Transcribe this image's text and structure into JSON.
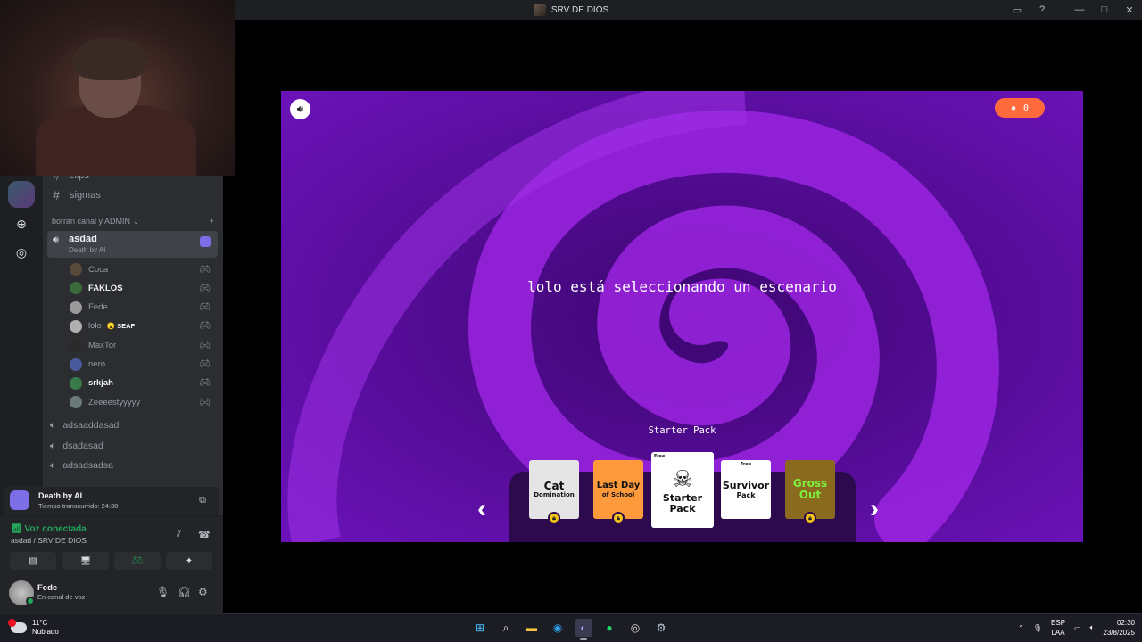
{
  "window": {
    "title": "SRV DE DIOS"
  },
  "sidebar": {
    "text_channels": [
      {
        "label": "clips"
      },
      {
        "label": "sigmas"
      }
    ],
    "category": "borran canal y ADMIN",
    "active_voice": {
      "name": "asdad",
      "activity": "Death by AI"
    },
    "members": [
      {
        "name": "Coca",
        "bold": false,
        "color": "#5a4a3a"
      },
      {
        "name": "FAKLOS",
        "bold": true,
        "color": "#3a6a3a"
      },
      {
        "name": "Fede",
        "bold": false,
        "color": "#9a9a9a"
      },
      {
        "name": "lolo",
        "bold": false,
        "color": "#b0b0b0",
        "tag": "SEAF"
      },
      {
        "name": "MaxTor",
        "bold": false,
        "color": "#2a2a2a"
      },
      {
        "name": "nero",
        "bold": false,
        "color": "#4a5a9a"
      },
      {
        "name": "srkjah",
        "bold": true,
        "color": "#3a7a4a"
      },
      {
        "name": "Zeeeestyyyyy",
        "bold": false,
        "color": "#6a7a7a"
      }
    ],
    "voice_channels": [
      {
        "label": "adsaaddasad"
      },
      {
        "label": "dsadasad"
      },
      {
        "label": "adsadsadsa"
      }
    ]
  },
  "activity_panel": {
    "title": "Death by AI",
    "elapsed": "Tiempo transcurrido: 24:38"
  },
  "voice_panel": {
    "status": "Voz conectada",
    "location": "asdad / SRV DE DIOS"
  },
  "user_panel": {
    "name": "Fede",
    "status": "En canal de voz"
  },
  "game": {
    "counter": "0",
    "status_message": "lolo está seleccionando un escenario",
    "selected_pack": "Starter Pack",
    "cards": [
      {
        "line1": "Cat",
        "line2": "Domination",
        "locked": true,
        "free": ""
      },
      {
        "line1": "Last Day",
        "line2": "of School",
        "locked": true,
        "free": ""
      },
      {
        "line1": "Starter",
        "line2": "Pack",
        "locked": false,
        "free": "Free"
      },
      {
        "line1": "Survivor",
        "line2": "Pack",
        "locked": false,
        "free": "Free"
      },
      {
        "line1": "Gross",
        "line2": "Out",
        "locked": true,
        "free": ""
      }
    ],
    "colors": {
      "accent": "#9b25e0",
      "counter": "#ff6a3d"
    }
  },
  "taskbar": {
    "weather_temp": "11°C",
    "weather_desc": "Nublado",
    "lang_1": "ESP",
    "lang_2": "LAA",
    "time": "02:30",
    "date": "23/8/2025"
  }
}
